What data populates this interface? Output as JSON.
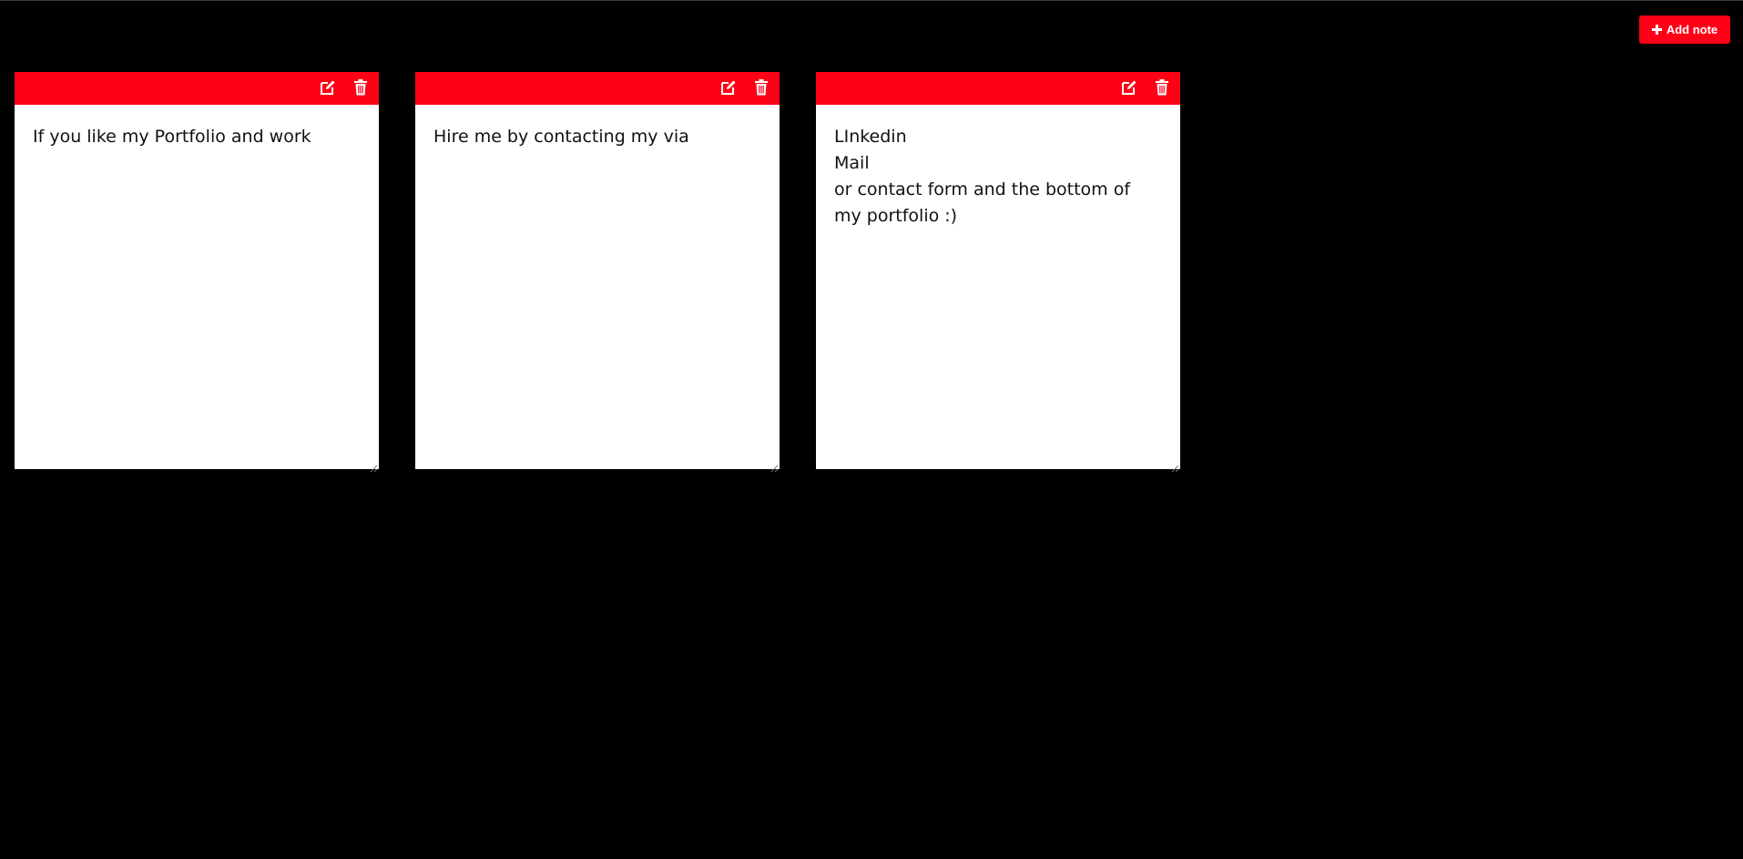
{
  "toolbar": {
    "add_note_label": "Add note",
    "add_note_icon": "plus-icon"
  },
  "colors": {
    "background": "#000000",
    "accent": "#ff0016",
    "note_background": "#ffffff",
    "note_text": "#111111"
  },
  "notes": [
    {
      "text": "If you like my Portfolio and work",
      "edit_icon": "edit-icon",
      "delete_icon": "trash-icon"
    },
    {
      "text": "Hire me by contacting my via",
      "edit_icon": "edit-icon",
      "delete_icon": "trash-icon"
    },
    {
      "text": "LInkedin\nMail\nor contact form and the bottom of my portfolio :)",
      "edit_icon": "edit-icon",
      "delete_icon": "trash-icon"
    }
  ]
}
